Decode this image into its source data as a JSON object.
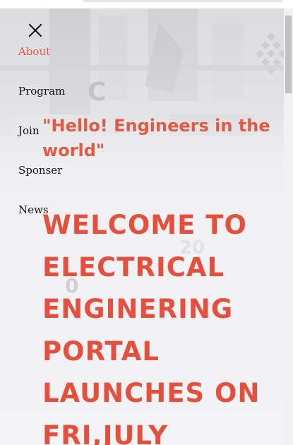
{
  "menu": {
    "close_icon": "close-icon",
    "items": [
      {
        "label": "About",
        "active": true
      },
      {
        "label": "Program",
        "active": false
      },
      {
        "label": "Join",
        "active": false
      },
      {
        "label": "Sponser",
        "active": false
      },
      {
        "label": "News",
        "active": false
      }
    ]
  },
  "hero": {
    "greeting": "\"Hello! Engineers in the world\"",
    "headline": "WELCOME TO ELECTRICAL ENGINERING PORTAL LAUNCHES ON FRI,JULY",
    "decor_letters": [
      "C",
      "0",
      "20"
    ]
  },
  "colors": {
    "accent": "#e05a45",
    "headline": "#e5503e",
    "nav_text": "#111111",
    "background": "#f1f1f3"
  }
}
